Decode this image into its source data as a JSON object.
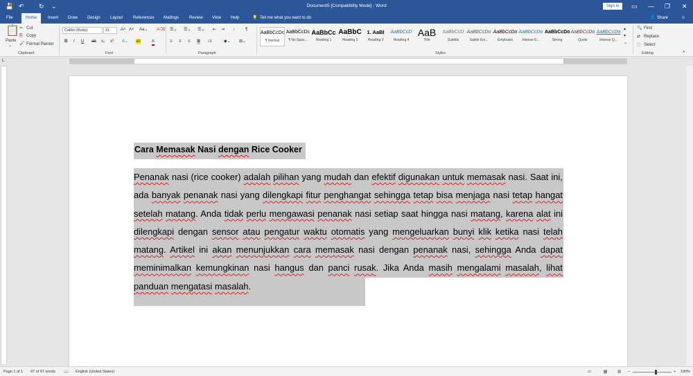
{
  "titlebar": {
    "title": "Document5 [Compatibility Mode] - Word",
    "sign_in": "Sign in",
    "save_icon": "💾",
    "undo_icon": "↶",
    "redo_icon": "↻",
    "customize_icon": "⌄",
    "minimize_icon": "—",
    "restore_icon": "▭",
    "maximize_icon": "❐",
    "close_icon": "✕"
  },
  "tabs": [
    "File",
    "Home",
    "Insert",
    "Draw",
    "Design",
    "Layout",
    "References",
    "Mailings",
    "Review",
    "View",
    "Help"
  ],
  "tell_me": "Tell me what you want to do",
  "share": "Share",
  "ribbon": {
    "clipboard": {
      "paste": "Paste",
      "cut": "Cut",
      "copy": "Copy",
      "format_painter": "Format Painter",
      "label": "Clipboard"
    },
    "font": {
      "name": "Calibri (Body)",
      "size": "11",
      "label": "Font"
    },
    "paragraph": {
      "label": "Paragraph"
    },
    "styles": {
      "label": "Styles",
      "items": [
        {
          "preview": "AaBbCcDc",
          "name": "¶ Normal"
        },
        {
          "preview": "AaBbCcDc",
          "name": "¶ No Spac..."
        },
        {
          "preview": "AaBbCc",
          "name": "Heading 1"
        },
        {
          "preview": "AaBbC",
          "name": "Heading 2"
        },
        {
          "preview": "1. AaBl",
          "name": "Heading 3"
        },
        {
          "preview": "AaBbCcD",
          "name": "Heading 4"
        },
        {
          "preview": "AaB",
          "name": "Title"
        },
        {
          "preview": "AaBbCcD",
          "name": "Subtitle"
        },
        {
          "preview": "AaBbCcDo",
          "name": "Subtle Em..."
        },
        {
          "preview": "AaBbCcDo",
          "name": "Emphasis"
        },
        {
          "preview": "AaBbCcDo",
          "name": "Intense E..."
        },
        {
          "preview": "AaBbCcDo",
          "name": "Strong"
        },
        {
          "preview": "AaBbCcDo",
          "name": "Quote"
        },
        {
          "preview": "AaBbCcDo",
          "name": "Intense Q..."
        }
      ]
    },
    "editing": {
      "find": "Find",
      "replace": "Replace",
      "select": "Select",
      "label": "Editing"
    }
  },
  "document": {
    "title_words": [
      "Cara",
      "Memasak",
      "Nasi",
      "dengan",
      "Rice",
      "Cooker"
    ],
    "paragraph": "Penanak nasi (rice cooker) adalah pilihan yang mudah dan efektif digunakan untuk memasak nasi. Saat ini, ada banyak penanak nasi yang dilengkapi fitur penghangat sehingga tetap bisa menjaga nasi tetap hangat setelah matang. Anda tidak perlu mengawasi penanak nasi setiap saat hingga nasi matang, karena alat ini dilengkapi dengan sensor atau pengatur waktu otomatis yang mengeluarkan bunyi klik ketika nasi telah matang. Artikel ini akan menunjukkan cara memasak nasi dengan penanak nasi, sehingga Anda dapat meminimalkan kemungkinan nasi hangus dan panci rusak. Jika Anda masih mengalami masalah, lihat panduan mengatasi masalah."
  },
  "status": {
    "page": "Page 1 of 1",
    "words": "97 of 97 words",
    "language": "English (United States)",
    "zoom": "190%"
  }
}
